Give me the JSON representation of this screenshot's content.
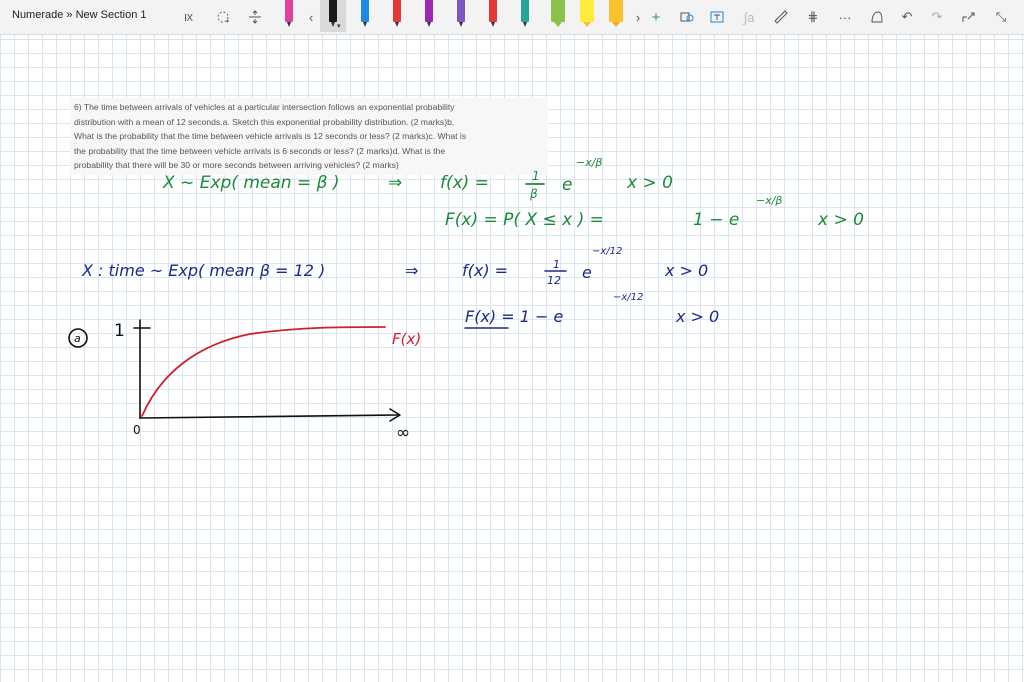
{
  "toolbar": {
    "breadcrumb": "Numerade » New Section 1",
    "pen_colors": [
      "#e040a0",
      "#1a1a1a",
      "#1e88e5",
      "#e53935",
      "#ff9800",
      "#9c27b0",
      "#e53935",
      "#26a69a",
      "#8bc34a",
      "#ffeb3b",
      "#fbc02d"
    ],
    "selected_pen": 1,
    "icons": [
      "text-select-icon",
      "lasso-icon",
      "insert-space-icon",
      "chevron-left-icon",
      "chevron-right-icon",
      "add-pen-icon",
      "ink-to-shape-icon",
      "ink-to-text-icon",
      "ink-to-math-icon",
      "ruler-icon",
      "grid-icon",
      "more-icon",
      "ink-replay-icon",
      "undo-icon",
      "redo-icon",
      "share-icon",
      "collapse-icon"
    ]
  },
  "question": {
    "lines": [
      "6) The time between arrivals of vehicles at a particular intersection follows an exponential probability",
      "distribution with a mean of 12 seconds.a. Sketch this exponential probability distribution. (2 marks)b.",
      "What is the probability that the time between vehicle arrivals is 12 seconds or less? (2 marks)c. What is",
      "the probability that the time between vehicle arrivals is 6 seconds or less? (2 marks)d. What is the",
      "probability that there will be 30 or more seconds between arriving vehicles? (2 marks)"
    ]
  },
  "notes": {
    "green_line1_left": "X ~ Exp( mean = β )",
    "green_arrow1": "⇒",
    "green_line1_f": "f(x) =",
    "green_frac_num": "1",
    "green_frac_den": "β",
    "green_e1": "e",
    "green_exp1": "−x/β",
    "green_cond1": "x > 0",
    "green_line2": "F(x) = P( X ≤ x ) =",
    "green_line2_rhs": "1 − e",
    "green_exp2": "−x/β",
    "green_cond2": "x > 0",
    "blue_line1_left": "X : time ~ Exp( mean β = 12 )",
    "blue_arrow1": "⇒",
    "blue_line1_f": "f(x) =",
    "blue_frac_num": "1",
    "blue_frac_den": "12",
    "blue_e1": "e",
    "blue_exp1": "−x/12",
    "blue_cond1": "x > 0",
    "blue_line2": "F(x) = 1 − e",
    "blue_exp2": "−x/12",
    "blue_cond2": "x > 0",
    "sketch_part_label": "a",
    "sketch_y_top": "1",
    "sketch_origin": "0",
    "sketch_x_end": "∞",
    "sketch_curve_label": "F(x)"
  },
  "colors": {
    "green_ink": "#1b8a3a",
    "blue_ink": "#1b2a88",
    "red_ink": "#d0202a",
    "grid": "#d9e6f2"
  }
}
